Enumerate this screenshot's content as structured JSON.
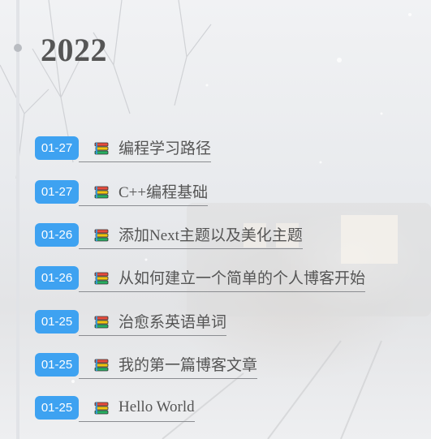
{
  "archive": {
    "year": "2022",
    "posts": [
      {
        "date": "01-27",
        "title": "编程学习路径",
        "icon": "books-icon"
      },
      {
        "date": "01-27",
        "title": "C++编程基础",
        "icon": "books-icon"
      },
      {
        "date": "01-26",
        "title": "添加Next主题以及美化主题",
        "icon": "books-icon"
      },
      {
        "date": "01-26",
        "title": "从如何建立一个简单的个人博客开始",
        "icon": "books-icon"
      },
      {
        "date": "01-25",
        "title": "治愈系英语单词",
        "icon": "books-icon"
      },
      {
        "date": "01-25",
        "title": "我的第一篇博客文章",
        "icon": "books-icon"
      },
      {
        "date": "01-25",
        "title": "Hello World",
        "icon": "books-icon"
      }
    ]
  },
  "colors": {
    "badge": "#3ea2f1",
    "title_text": "#555555"
  }
}
